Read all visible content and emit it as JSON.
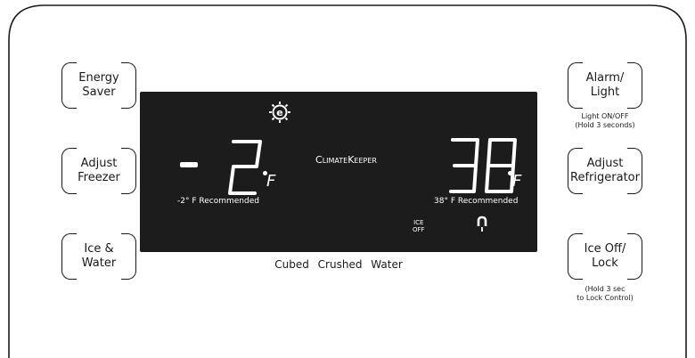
{
  "left_buttons": [
    {
      "line1": "Energy",
      "line2": "Saver"
    },
    {
      "line1": "Adjust",
      "line2": "Freezer"
    },
    {
      "line1": "Ice &",
      "line2": "Water"
    }
  ],
  "right_buttons": [
    {
      "line1": "Alarm/",
      "line2": "Light"
    },
    {
      "line1": "Adjust",
      "line2": "Refrigerator"
    },
    {
      "line1": "Ice Off/",
      "line2": "Lock"
    }
  ],
  "notes": {
    "light_line1": "Light ON/OFF",
    "light_line2": "(Hold 3 seconds)",
    "lock_line1": "(Hold 3 sec",
    "lock_line2": "to Lock Control)"
  },
  "display": {
    "brand_main_prefix": "C",
    "brand_main_rest": "LIMATE",
    "brand_second_prefix": "K",
    "brand_second_rest": "EEPER",
    "freezer_sign": "-",
    "freezer_value": "2",
    "freezer_unit": "F",
    "freezer_recommended": "-2° F Recommended",
    "fridge_value": "38",
    "fridge_unit": "F",
    "fridge_recommended": "38° F Recommended",
    "ice_off_line1": "ICE",
    "ice_off_line2": "OFF",
    "energy_icon": "energy-saver-icon",
    "lock_icon": "lock-icon"
  },
  "dispenser_modes": [
    "Cubed",
    "Crushed",
    "Water"
  ]
}
